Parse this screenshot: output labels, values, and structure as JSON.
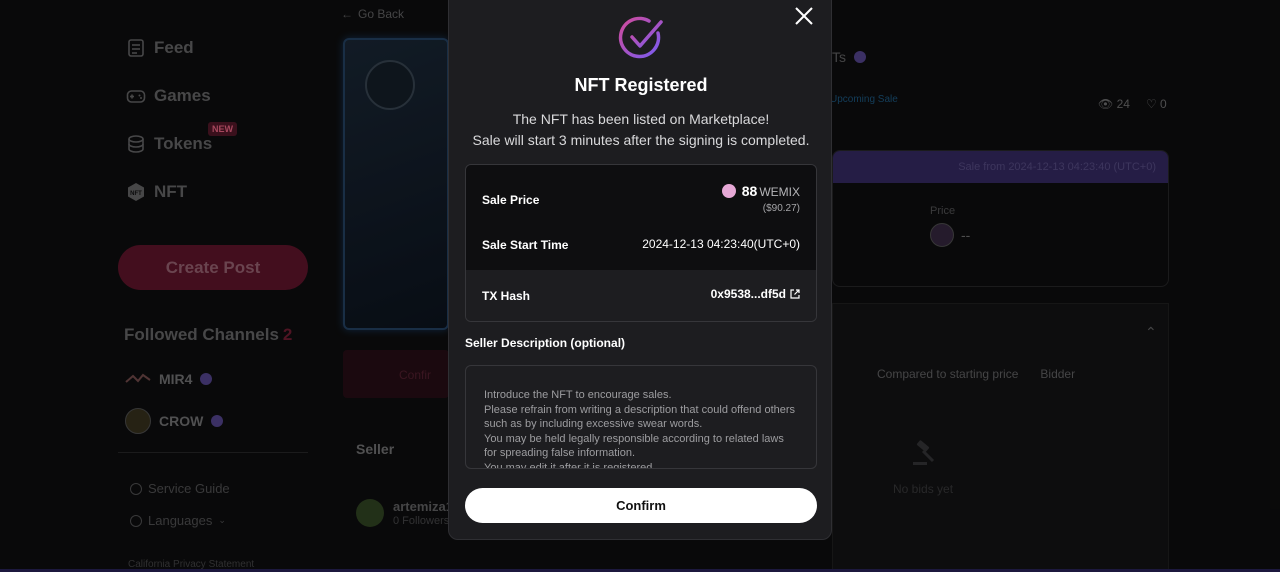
{
  "sidebar": {
    "nav": [
      {
        "label": "Feed",
        "icon": "feed-icon"
      },
      {
        "label": "Games",
        "icon": "gamepad-icon"
      },
      {
        "label": "Tokens",
        "icon": "coins-icon"
      },
      {
        "label": "NFT",
        "icon": "nft-hex-icon"
      }
    ],
    "new_badge": "NEW",
    "create_post": "Create Post",
    "followed_title": "Followed Channels",
    "followed_count": "2",
    "channels": [
      {
        "name": "MIR4"
      },
      {
        "name": "CROW"
      }
    ],
    "service_guide": "Service Guide",
    "languages": "Languages",
    "privacy": "California Privacy Statement"
  },
  "main": {
    "go_back": "Go Back",
    "confirm_frag": "Confir",
    "seller_label": "Seller",
    "seller_name": "artemiza1",
    "seller_followers": "0 Followers"
  },
  "right": {
    "title_frag": "Ts",
    "upcoming": "Upcoming Sale",
    "views": "24",
    "likes": "0",
    "sale_from": "Sale from 2024-12-13 04:23:40 (UTC+0)",
    "price_label": "Price",
    "price_value": "--",
    "compared": "Compared to starting price",
    "bidder": "Bidder",
    "no_bids": "No bids yet"
  },
  "modal": {
    "title": "NFT Registered",
    "message_line1": "The NFT has been listed on Marketplace!",
    "message_line2": "Sale will start 3 minutes after the signing is completed.",
    "sale_price_label": "Sale Price",
    "sale_price": "88",
    "currency": "WEMIX",
    "usd": "($90.27)",
    "start_time_label": "Sale Start Time",
    "start_time": "2024-12-13 04:23:40(UTC+0)",
    "tx_label": "TX Hash",
    "tx_hash": "0x9538...df5d",
    "desc_label": "Seller Description (optional)",
    "desc_placeholder": "Introduce the NFT to encourage sales.\nPlease refrain from writing a description that could offend others such as by including excessive swear words.\nYou may be held legally responsible according to related laws for spreading false information.\nYou may edit it after it is registered.",
    "confirm": "Confirm"
  },
  "colors": {
    "accent_purple": "#8b5cf6",
    "accent_pink": "#e0467a",
    "modal_bg": "#1d1d20"
  }
}
